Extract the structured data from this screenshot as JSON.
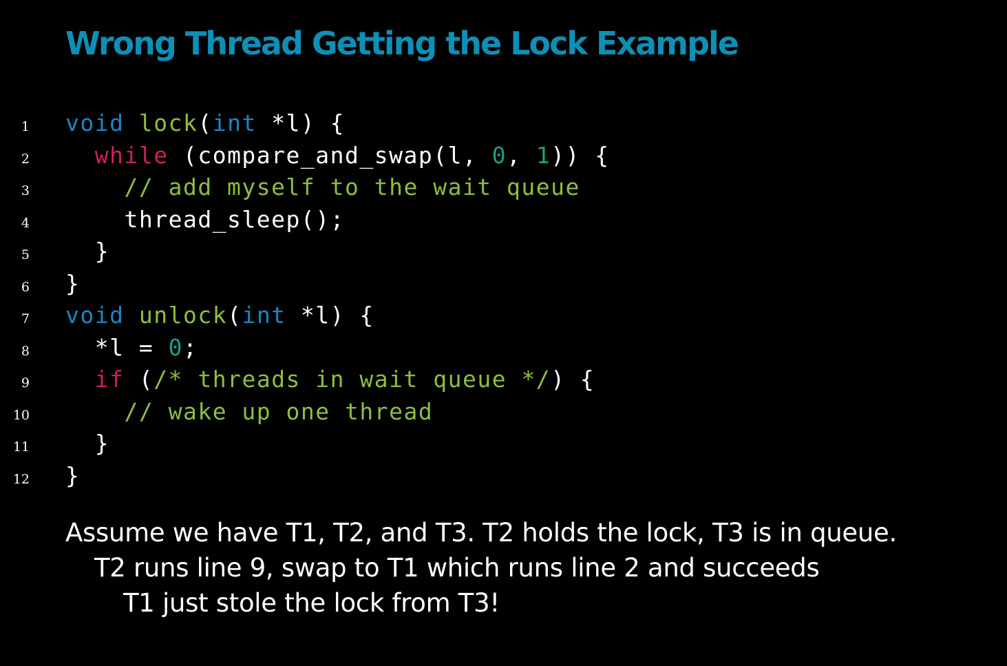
{
  "title": "Wrong Thread Getting the Lock Example",
  "colors": {
    "background": "#000000",
    "title": "#0e8fb6",
    "default_text": "#ffffff",
    "keyword": "#1d86c4",
    "type": "#1d86c4",
    "control": "#cc1f63",
    "comment": "#8ebf3c",
    "number": "#1a9e86",
    "ident": "#ffffff"
  },
  "code": {
    "lines": [
      {
        "num": "1",
        "indent": "",
        "tokens": [
          {
            "t": "void",
            "k": "keyword"
          },
          {
            "t": " ",
            "k": "ident"
          },
          {
            "t": "lock",
            "k": "comment"
          },
          {
            "t": "(",
            "k": "ident"
          },
          {
            "t": "int",
            "k": "type"
          },
          {
            "t": " *l) {",
            "k": "ident"
          }
        ]
      },
      {
        "num": "2",
        "indent": "  ",
        "tokens": [
          {
            "t": "while",
            "k": "control"
          },
          {
            "t": " (compare_and_swap(l, ",
            "k": "ident"
          },
          {
            "t": "0",
            "k": "number"
          },
          {
            "t": ", ",
            "k": "ident"
          },
          {
            "t": "1",
            "k": "number"
          },
          {
            "t": ")) {",
            "k": "ident"
          }
        ]
      },
      {
        "num": "3",
        "indent": "    ",
        "tokens": [
          {
            "t": "// add myself to the wait queue",
            "k": "comment"
          }
        ]
      },
      {
        "num": "4",
        "indent": "    ",
        "tokens": [
          {
            "t": "thread_sleep();",
            "k": "ident"
          }
        ]
      },
      {
        "num": "5",
        "indent": "  ",
        "tokens": [
          {
            "t": "}",
            "k": "ident"
          }
        ]
      },
      {
        "num": "6",
        "indent": "",
        "tokens": [
          {
            "t": "}",
            "k": "ident"
          }
        ]
      },
      {
        "num": "7",
        "indent": "",
        "tokens": [
          {
            "t": "void",
            "k": "keyword"
          },
          {
            "t": " ",
            "k": "ident"
          },
          {
            "t": "unlock",
            "k": "comment"
          },
          {
            "t": "(",
            "k": "ident"
          },
          {
            "t": "int",
            "k": "type"
          },
          {
            "t": " *l) {",
            "k": "ident"
          }
        ]
      },
      {
        "num": "8",
        "indent": "  ",
        "tokens": [
          {
            "t": "*l = ",
            "k": "ident"
          },
          {
            "t": "0",
            "k": "number"
          },
          {
            "t": ";",
            "k": "ident"
          }
        ]
      },
      {
        "num": "9",
        "indent": "  ",
        "tokens": [
          {
            "t": "if",
            "k": "control"
          },
          {
            "t": " (",
            "k": "ident"
          },
          {
            "t": "/* threads in wait queue */",
            "k": "comment"
          },
          {
            "t": ") {",
            "k": "ident"
          }
        ]
      },
      {
        "num": "10",
        "indent": "    ",
        "tokens": [
          {
            "t": "// wake up one thread",
            "k": "comment"
          }
        ]
      },
      {
        "num": "11",
        "indent": "  ",
        "tokens": [
          {
            "t": "}",
            "k": "ident"
          }
        ]
      },
      {
        "num": "12",
        "indent": "",
        "tokens": [
          {
            "t": "}",
            "k": "ident"
          }
        ]
      }
    ]
  },
  "explanation": {
    "line1": "Assume we have T1, T2, and T3.  T2 holds the lock, T3 is in queue.",
    "line2": "T2 runs line 9, swap to T1 which runs line 2 and succeeds",
    "line3": "T1 just stole the lock from T3!"
  }
}
